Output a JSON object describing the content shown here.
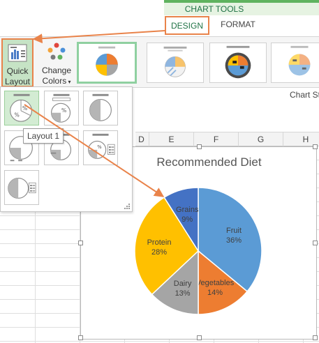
{
  "ribbon": {
    "chart_tools_label": "CHART TOOLS",
    "tabs": [
      {
        "label": "DESIGN",
        "selected": true
      },
      {
        "label": "FORMAT",
        "selected": false
      }
    ],
    "quick_layout_label_1": "Quick",
    "quick_layout_label_2": "Layout",
    "change_colors_label_1": "Change",
    "change_colors_label_2": "Colors",
    "chart_styles_caption": "Chart Sty",
    "accent_color": "#217346",
    "highlight_color": "#e9834a"
  },
  "gallery": {
    "thumbnails": [
      {
        "style": "pie-labels",
        "selected": true
      },
      {
        "style": "pie-hatched",
        "selected": false
      },
      {
        "style": "pie-dark-bg",
        "selected": false
      },
      {
        "style": "pie-light",
        "selected": false
      }
    ]
  },
  "dropdown": {
    "options": [
      {
        "name": "Layout 1",
        "selected": true
      },
      {
        "name": "Layout 2",
        "selected": false
      },
      {
        "name": "Layout 3",
        "selected": false
      },
      {
        "name": "Layout 4",
        "selected": false
      },
      {
        "name": "Layout 5",
        "selected": false
      },
      {
        "name": "Layout 6",
        "selected": false
      },
      {
        "name": "Layout 7",
        "selected": false
      }
    ],
    "tooltip": "Layout 1"
  },
  "sheet": {
    "columns": [
      "D",
      "E",
      "F",
      "G",
      "H"
    ]
  },
  "chart_data": {
    "type": "pie",
    "title": "Recommended Diet",
    "categories": [
      "Fruit",
      "Vegetables",
      "Dairy",
      "Protein",
      "Grains"
    ],
    "values": [
      36,
      14,
      13,
      28,
      9
    ],
    "labels": [
      "36%",
      "14%",
      "13%",
      "28%",
      "9%"
    ],
    "colors": [
      "#5b9bd5",
      "#ed7d31",
      "#a5a5a5",
      "#ffc000",
      "#4472c4"
    ],
    "legend": "none",
    "data_labels": "category name and percentage"
  }
}
